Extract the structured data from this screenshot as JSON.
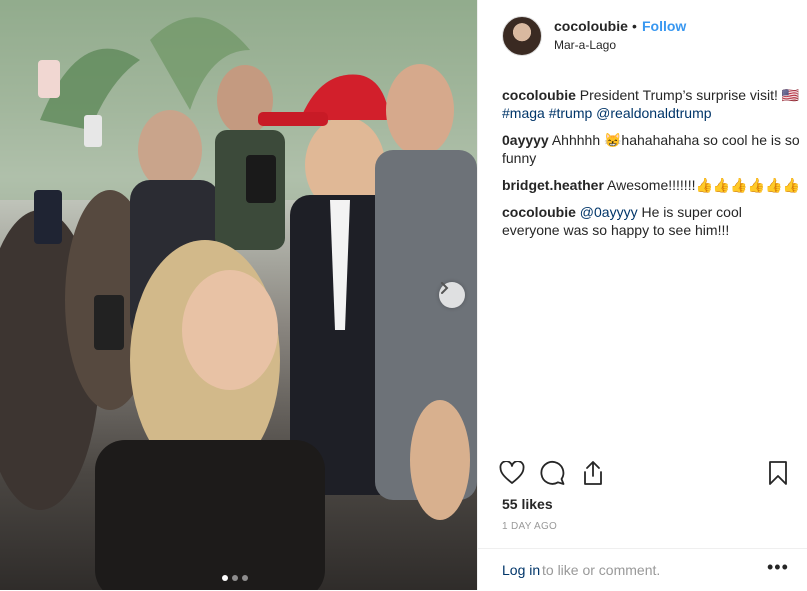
{
  "post": {
    "username": "cocoloubie",
    "follow_label": "Follow",
    "separator": "•",
    "location": "Mar-a-Lago",
    "comments": [
      {
        "user": "cocoloubie",
        "text": "President Trump’s surprise visit! 🇺🇸 ",
        "tags": "#maga #trump @realdonaldtrump"
      },
      {
        "user": "0ayyyy",
        "text": "Ahhhhh 😸hahahahaha so cool he is so funny"
      },
      {
        "user": "bridget.heather",
        "text": "Awesome!!!!!!!👍👍👍👍👍👍"
      },
      {
        "user": "cocoloubie",
        "mention": "@0ayyyy",
        "text": " He is super cool everyone was so happy to see him!!!"
      }
    ],
    "likes": "55 likes",
    "time": "1 DAY AGO",
    "login_link": "Log in",
    "login_rest": " to like or comment.",
    "more_label": "•••"
  },
  "carousel": {
    "slides": 3,
    "active": 0
  },
  "icons": [
    "heart-icon",
    "comment-icon",
    "share-icon",
    "bookmark-icon",
    "chevron-right-icon"
  ],
  "colors": {
    "accent": "#3897f0",
    "link": "#003569",
    "muted": "#999999",
    "text": "#262626"
  }
}
